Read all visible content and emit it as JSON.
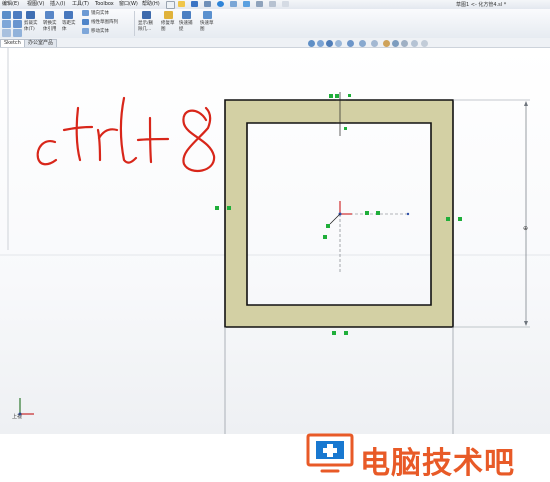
{
  "menu": {
    "items": [
      "编辑(E)",
      "视图(V)",
      "插入(I)",
      "工具(T)",
      "Toolbox",
      "窗口(W)",
      "帮助(H)"
    ],
    "document_title": "草图1 <- 化方管4.sl *"
  },
  "toolbar": {
    "labels": {
      "shaded_label": "剪裁实",
      "shaded_sub": "体(T)",
      "convert_label": "转换实",
      "convert_sub": "体引用",
      "offset_label": "等距实",
      "offset_sub": "体",
      "mirror_label": "镜向实体",
      "linear_label": "线性草图阵列",
      "move_label": "移动实体",
      "display_label": "显示/删",
      "display_sub": "除几...",
      "repair_label": "修复草",
      "repair_sub": "图",
      "quick_label": "快速捕",
      "quick_sub": "捉",
      "instant_label": "快速草",
      "instant_sub": "图"
    }
  },
  "tabs": [
    "Sketch",
    "办公室产品"
  ],
  "sketch": {
    "handwriting": "ctrl+8"
  },
  "status": {
    "coord_label": "上视"
  },
  "watermark": {
    "text": "电脑技术吧"
  },
  "colors": {
    "tube": "#d3d0a4",
    "tube_edge": "#111111",
    "relation_green": "#1fae3a",
    "handwriting_red": "#d8261a",
    "watermark_orange": "#e85a27",
    "watermark_blue": "#1878d0"
  }
}
